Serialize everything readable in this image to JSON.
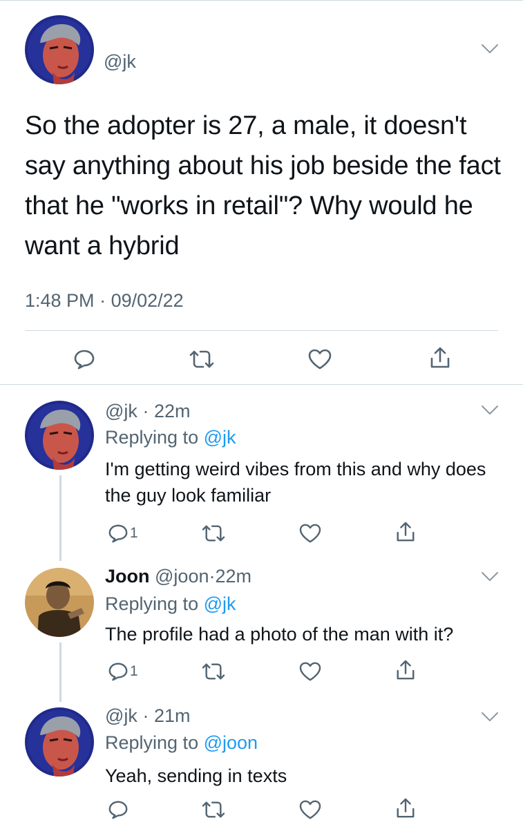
{
  "main_tweet": {
    "handle": "@jk",
    "text": "So the adopter is 27, a male, it doesn't say anything about his job beside the fact that he \"works in retail\"? Why would he want a hybrid",
    "time": "1:48 PM",
    "date": "09/02/22",
    "meta_separator": "·"
  },
  "replies": [
    {
      "name": "",
      "handle": "@jk",
      "separator": "·",
      "time": "22m",
      "replying_prefix": "Replying to",
      "replying_to": "@jk",
      "text": "I'm getting weird vibes from this and why does the guy look familiar",
      "reply_count": "1"
    },
    {
      "name": "Joon",
      "handle": "@joon",
      "separator": "·",
      "time": "22m",
      "replying_prefix": "Replying to",
      "replying_to": "@jk",
      "text": "The profile had a photo of the man with it?",
      "reply_count": "1"
    },
    {
      "name": "",
      "handle": "@jk",
      "separator": "·",
      "time": "21m",
      "replying_prefix": "Replying to",
      "replying_to": "@joon",
      "text": "Yeah, sending in texts",
      "reply_count": ""
    }
  ],
  "icons": {
    "reply": "speech-bubble-icon",
    "retweet": "retweet-arrows-icon",
    "like": "heart-icon",
    "share": "share-upload-icon",
    "more": "chevron-down-icon"
  },
  "colors": {
    "text": "#0f1419",
    "muted": "#536471",
    "link": "#1d9bf0",
    "divider": "#cfd9de"
  }
}
